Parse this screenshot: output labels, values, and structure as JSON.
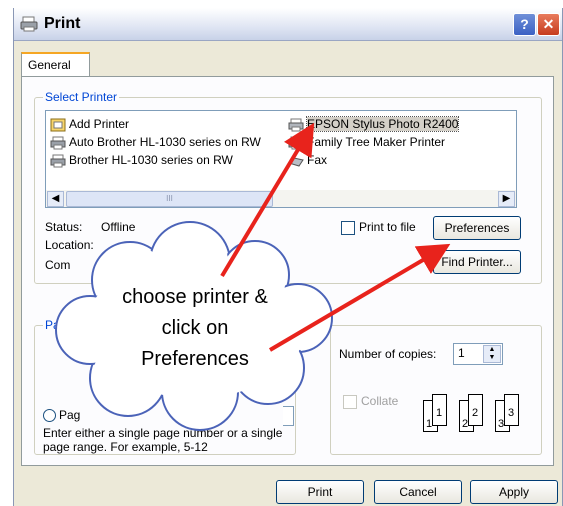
{
  "window": {
    "title": "Print",
    "help_glyph": "?",
    "close_glyph": "✕"
  },
  "tabs": [
    {
      "label": "General"
    }
  ],
  "select_printer": {
    "legend": "Select Printer",
    "printers": [
      {
        "name": "Add Printer",
        "icon": "add-printer-icon"
      },
      {
        "name": "Auto Brother HL-1030 series on RW",
        "icon": "printer-icon"
      },
      {
        "name": "Brother HL-1030 series on RW",
        "icon": "printer-icon"
      },
      {
        "name": "EPSON Stylus Photo R2400",
        "icon": "printer-icon",
        "selected": true
      },
      {
        "name": "Family Tree Maker Printer",
        "icon": "printer-icon"
      },
      {
        "name": "Fax",
        "icon": "fax-icon"
      }
    ],
    "status_label": "Status:",
    "status_value": "Offline",
    "location_label": "Location:",
    "comment_label": "Com",
    "print_to_file_label": "Print to file",
    "preferences_label": "Preferences",
    "find_printer_label": "Find Printer..."
  },
  "page_range": {
    "legend_partial": "Pa",
    "pages_label_partial": "Pag",
    "help_text_1": "Enter either a single page number or a single",
    "help_text_2": "page range.  For example, 5-12"
  },
  "copies": {
    "number_label": "Number of copies:",
    "number_value": "1",
    "collate_label": "Collate",
    "page_labels": [
      "1",
      "1",
      "2",
      "2",
      "3",
      "3"
    ]
  },
  "buttons": {
    "print": "Print",
    "cancel": "Cancel",
    "apply": "Apply"
  },
  "annotation": {
    "line1": "choose printer &",
    "line2": "click on",
    "line3": "Preferences",
    "arrow_color": "#e8231c"
  },
  "scroll": {
    "left_glyph": "◀",
    "right_glyph": "▶",
    "thumb_grip": "III"
  }
}
